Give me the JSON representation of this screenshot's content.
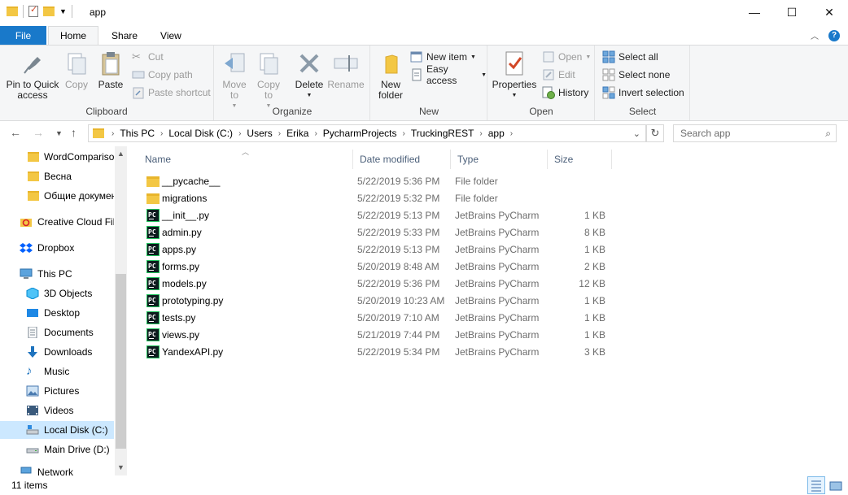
{
  "window": {
    "title": "app",
    "minimize_glyph": "—",
    "maximize_glyph": "☐",
    "close_glyph": "✕"
  },
  "ribbon_tabs": [
    "File",
    "Home",
    "Share",
    "View"
  ],
  "ribbon": {
    "clipboard": {
      "label": "Clipboard",
      "pin": "Pin to Quick access",
      "copy": "Copy",
      "paste": "Paste",
      "cut": "Cut",
      "copy_path": "Copy path",
      "paste_shortcut": "Paste shortcut"
    },
    "organize": {
      "label": "Organize",
      "move_to": "Move to",
      "copy_to": "Copy to",
      "delete": "Delete",
      "rename": "Rename"
    },
    "new": {
      "label": "New",
      "new_folder": "New folder",
      "new_item": "New item",
      "easy_access": "Easy access"
    },
    "open": {
      "label": "Open",
      "properties": "Properties",
      "open": "Open",
      "edit": "Edit",
      "history": "History"
    },
    "select": {
      "label": "Select",
      "select_all": "Select all",
      "select_none": "Select none",
      "invert_selection": "Invert selection"
    }
  },
  "address": {
    "crumbs": [
      "This PC",
      "Local Disk (C:)",
      "Users",
      "Erika",
      "PycharmProjects",
      "TruckingREST",
      "app"
    ]
  },
  "search": {
    "placeholder": "Search app"
  },
  "navpane": {
    "items": [
      {
        "label": "WordComparison",
        "icon": "folder-icon"
      },
      {
        "label": "Весна",
        "icon": "folder-icon"
      },
      {
        "label": "Общие документы",
        "icon": "folder-icon"
      },
      {
        "label": "Creative Cloud Files",
        "icon": "creative-cloud-icon"
      },
      {
        "label": "Dropbox",
        "icon": "dropbox-icon"
      },
      {
        "label": "This PC",
        "icon": "computer-icon"
      },
      {
        "label": "3D Objects",
        "icon": "3d-objects-icon"
      },
      {
        "label": "Desktop",
        "icon": "desktop-icon"
      },
      {
        "label": "Documents",
        "icon": "documents-icon"
      },
      {
        "label": "Downloads",
        "icon": "downloads-icon"
      },
      {
        "label": "Music",
        "icon": "music-icon"
      },
      {
        "label": "Pictures",
        "icon": "pictures-icon"
      },
      {
        "label": "Videos",
        "icon": "videos-icon"
      },
      {
        "label": "Local Disk (C:)",
        "icon": "local-disk-icon"
      },
      {
        "label": "Main Drive (D:)",
        "icon": "drive-icon"
      },
      {
        "label": "Network",
        "icon": "network-icon"
      }
    ]
  },
  "columns": {
    "name": "Name",
    "date": "Date modified",
    "type": "Type",
    "size": "Size"
  },
  "files": [
    {
      "name": "__pycache__",
      "date": "5/22/2019 5:36 PM",
      "type": "File folder",
      "size": "",
      "kind": "folder"
    },
    {
      "name": "migrations",
      "date": "5/22/2019 5:32 PM",
      "type": "File folder",
      "size": "",
      "kind": "folder"
    },
    {
      "name": "__init__.py",
      "date": "5/22/2019 5:13 PM",
      "type": "JetBrains PyCharm",
      "size": "1 KB",
      "kind": "py"
    },
    {
      "name": "admin.py",
      "date": "5/22/2019 5:33 PM",
      "type": "JetBrains PyCharm",
      "size": "8 KB",
      "kind": "py"
    },
    {
      "name": "apps.py",
      "date": "5/22/2019 5:13 PM",
      "type": "JetBrains PyCharm",
      "size": "1 KB",
      "kind": "py"
    },
    {
      "name": "forms.py",
      "date": "5/20/2019 8:48 AM",
      "type": "JetBrains PyCharm",
      "size": "2 KB",
      "kind": "py"
    },
    {
      "name": "models.py",
      "date": "5/22/2019 5:36 PM",
      "type": "JetBrains PyCharm",
      "size": "12 KB",
      "kind": "py"
    },
    {
      "name": "prototyping.py",
      "date": "5/20/2019 10:23 AM",
      "type": "JetBrains PyCharm",
      "size": "1 KB",
      "kind": "py"
    },
    {
      "name": "tests.py",
      "date": "5/20/2019 7:10 AM",
      "type": "JetBrains PyCharm",
      "size": "1 KB",
      "kind": "py"
    },
    {
      "name": "views.py",
      "date": "5/21/2019 7:44 PM",
      "type": "JetBrains PyCharm",
      "size": "1 KB",
      "kind": "py"
    },
    {
      "name": "YandexAPI.py",
      "date": "5/22/2019 5:34 PM",
      "type": "JetBrains PyCharm",
      "size": "3 KB",
      "kind": "py"
    }
  ],
  "status": {
    "item_count": "11 items"
  },
  "colors": {
    "accent": "#1979ca",
    "selected": "#cce8ff",
    "folder": "#f3c744"
  }
}
